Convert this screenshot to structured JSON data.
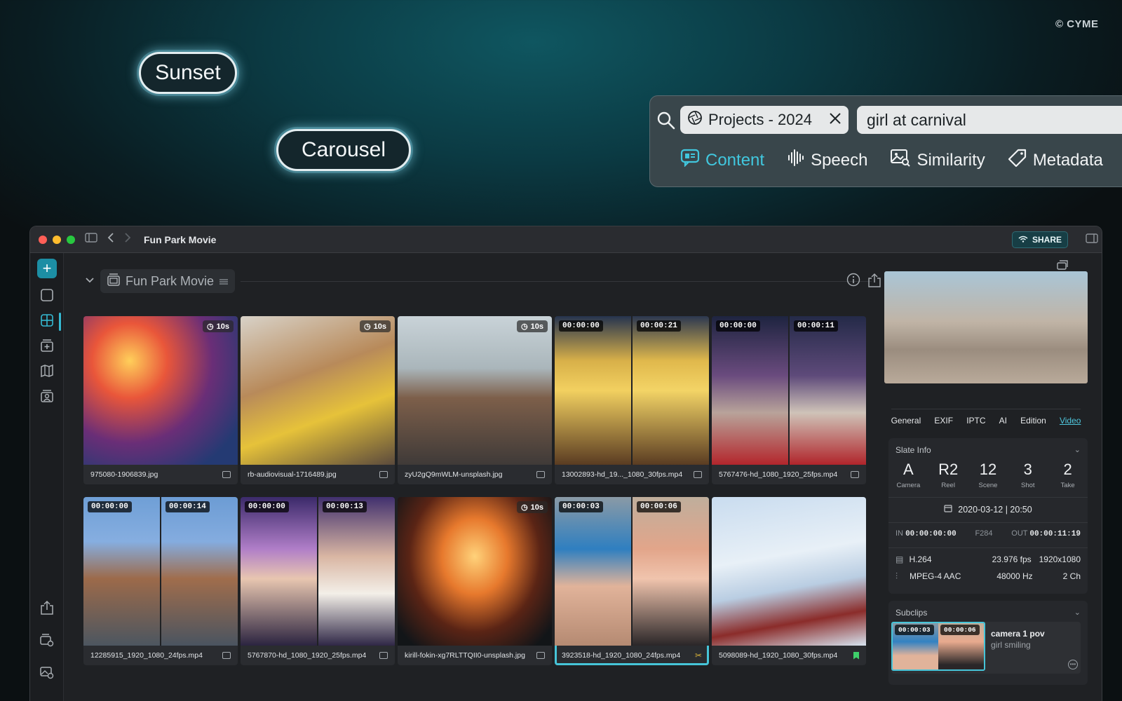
{
  "copyright": "© CYME",
  "bubbles": {
    "sunset": "Sunset",
    "carousel": "Carousel"
  },
  "search": {
    "scope": "Projects - 2024",
    "query": "girl at carnival",
    "modes": [
      {
        "label": "Content",
        "icon": "content-icon",
        "active": true
      },
      {
        "label": "Speech",
        "icon": "waveform-icon",
        "active": false
      },
      {
        "label": "Similarity",
        "icon": "image-search-icon",
        "active": false
      },
      {
        "label": "Metadata",
        "icon": "tag-icon",
        "active": false
      }
    ]
  },
  "window": {
    "title": "Fun Park Movie",
    "share_label": "SHARE"
  },
  "collection": {
    "name": "Fun Park Movie"
  },
  "assets": [
    {
      "name": "975080-1906839.jpg",
      "duration": "10s",
      "type": "image"
    },
    {
      "name": "rb-audiovisual-1716489.jpg",
      "duration": "10s",
      "type": "image"
    },
    {
      "name": "zyU2gQ9mWLM-unsplash.jpg",
      "duration": "10s",
      "type": "image"
    },
    {
      "name": "13002893-hd_19..._1080_30fps.mp4",
      "tc_in": "00:00:00",
      "tc_out": "00:00:21",
      "type": "video"
    },
    {
      "name": "5767476-hd_1080_1920_25fps.mp4",
      "tc_in": "00:00:00",
      "tc_out": "00:00:11",
      "type": "video"
    },
    {
      "name": "12285915_1920_1080_24fps.mp4",
      "tc_in": "00:00:00",
      "tc_out": "00:00:14",
      "type": "video"
    },
    {
      "name": "5767870-hd_1080_1920_25fps.mp4",
      "tc_in": "00:00:00",
      "tc_out": "00:00:13",
      "type": "video"
    },
    {
      "name": "kirill-fokin-xg7RLTTQII0-unsplash.jpg",
      "duration": "10s",
      "type": "image"
    },
    {
      "name": "3923518-hd_1920_1080_24fps.mp4",
      "tc_in": "00:00:03",
      "tc_out": "00:00:06",
      "type": "video",
      "selected": true
    },
    {
      "name": "5098089-hd_1920_1080_30fps.mp4",
      "type": "image",
      "flag": "green"
    }
  ],
  "inspector": {
    "tabs": [
      "General",
      "EXIF",
      "IPTC",
      "AI",
      "Edition",
      "Video"
    ],
    "active_tab": "Video",
    "slate_title": "Slate Info",
    "slate": [
      {
        "value": "A",
        "label": "Camera"
      },
      {
        "value": "R2",
        "label": "Reel"
      },
      {
        "value": "12",
        "label": "Scene"
      },
      {
        "value": "3",
        "label": "Shot"
      },
      {
        "value": "2",
        "label": "Take"
      }
    ],
    "datetime": "2020-03-12 | 20:50",
    "in_label": "IN",
    "in_tc": "00:00:00:00",
    "frames": "F284",
    "out_label": "OUT",
    "out_tc": "00:00:11:19",
    "video_codec": "H.264",
    "fps": "23.976 fps",
    "resolution": "1920x1080",
    "audio_codec": "MPEG-4 AAC",
    "sample_rate": "48000 Hz",
    "channels": "2 Ch",
    "subclips_title": "Subclips",
    "subclip": {
      "tc_in": "00:00:03",
      "tc_out": "00:00:06",
      "title": "camera 1 pov",
      "desc": "girl smiling"
    }
  },
  "colors": {
    "accent": "#46c4d8",
    "share_bg": "#173e45"
  }
}
